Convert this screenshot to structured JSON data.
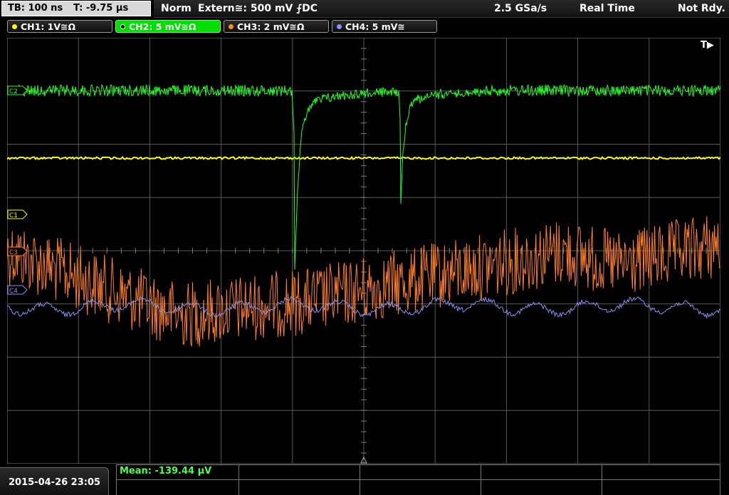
{
  "topbar": {
    "timebase": "TB: 100 ns",
    "trigger_pos": "T: -9.75 µs",
    "mode": "Norm",
    "trigger_source": "Extern≅: 500 mV ⨍DC",
    "sample_rate": "2.5 GSa/s",
    "acq_mode": "Real Time",
    "status": "Not Rdy."
  },
  "channels": [
    {
      "label": "CH1: 1V≅Ω",
      "color": "#ffff00",
      "active": false
    },
    {
      "label": "CH2: 5 mV≅Ω",
      "color": "#00ff00",
      "active": true
    },
    {
      "label": "CH3: 2 mV≅Ω",
      "color": "#ff8c1a",
      "active": false
    },
    {
      "label": "CH4: 5 mV≅",
      "color": "#8f8fff",
      "active": false
    }
  ],
  "screen": {
    "trigger_marker": "T▶",
    "markers": {
      "ch1": "C1",
      "ch2": "C2",
      "ch3": "C3",
      "ch4": "C4"
    }
  },
  "colors": {
    "ch1": "#ffff00",
    "ch2": "#22ff22",
    "ch3": "#ff7f24",
    "ch4": "#8a8ff0",
    "grid": "#5a5a5a",
    "grid_center": "#7a7a7a"
  },
  "measurement": {
    "label": "Mean: -139.44 µV"
  },
  "timestamp": "2015-04-26 23:05"
}
